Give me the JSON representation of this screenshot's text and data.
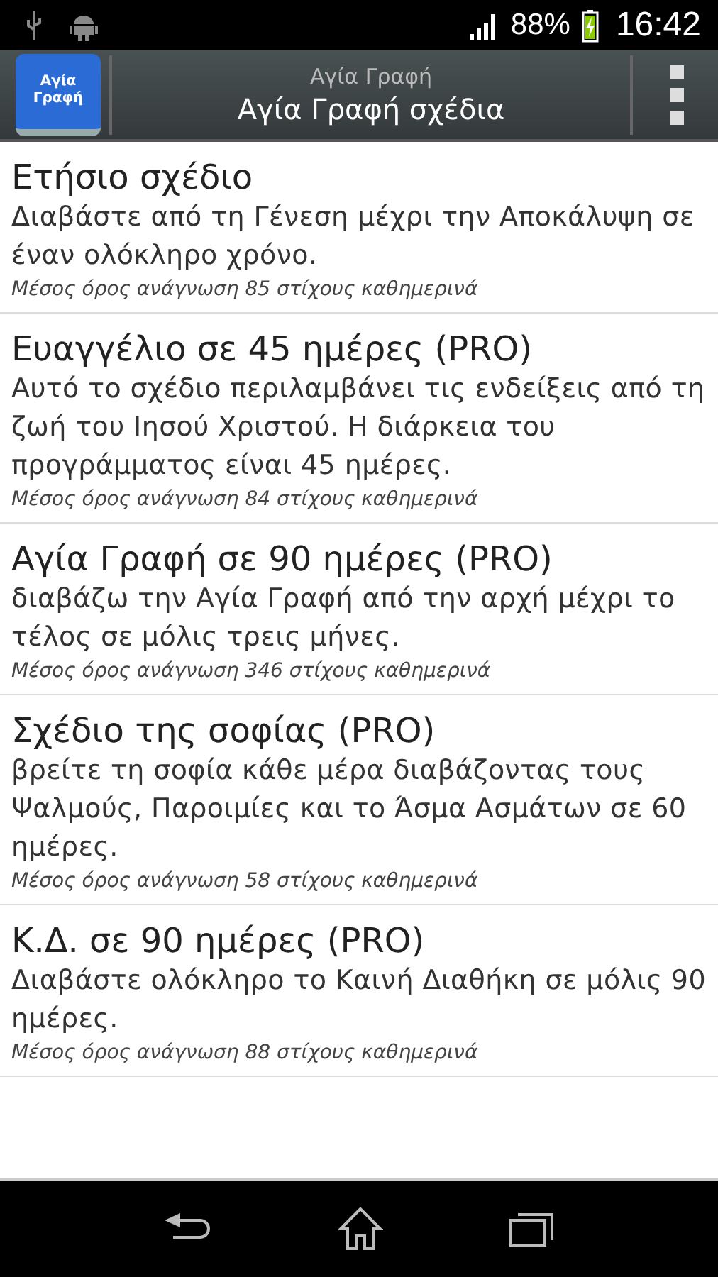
{
  "status_bar": {
    "battery": "88%",
    "time": "16:42"
  },
  "action_bar": {
    "icon_label": "Αγία Γραφή",
    "subtitle": "Αγία Γραφή",
    "title": "Αγία Γραφή σχέδια"
  },
  "plans": [
    {
      "title": "Ετήσιο σχέδιο",
      "description": "Διαβάστε από τη Γένεση μέχρι την Αποκάλυψη σε έναν ολόκληρο χρόνο.",
      "note": "Μέσος όρος ανάγνωση 85 στίχους καθημερινά"
    },
    {
      "title": "Ευαγγέλιο σε 45 ημέρες (PRO)",
      "description": "Αυτό το σχέδιο περιλαμβάνει τις ενδείξεις από τη ζωή του Ιησού Χριστού. Η διάρκεια του προγράμματος είναι 45 ημέρες.",
      "note": "Μέσος όρος ανάγνωση 84 στίχους καθημερινά"
    },
    {
      "title": "Αγία Γραφή σε 90 ημέρες (PRO)",
      "description": "διαβάζω την Αγία Γραφή από την αρχή μέχρι το τέλος σε μόλις τρεις μήνες.",
      "note": "Μέσος όρος ανάγνωση 346 στίχους καθημερινά"
    },
    {
      "title": "Σχέδιο της σοφίας (PRO)",
      "description": "βρείτε τη σοφία κάθε μέρα διαβάζοντας τους Ψαλμούς, Παροιμίες και το Άσμα Ασμάτων σε 60 ημέρες.",
      "note": "Μέσος όρος ανάγνωση 58 στίχους καθημερινά"
    },
    {
      "title": "Κ.Δ. σε 90 ημέρες (PRO)",
      "description": "Διαβάστε ολόκληρο το Καινή Διαθήκη σε μόλις 90 ημέρες.",
      "note": "Μέσος όρος ανάγνωση 88 στίχους καθημερινά"
    }
  ]
}
